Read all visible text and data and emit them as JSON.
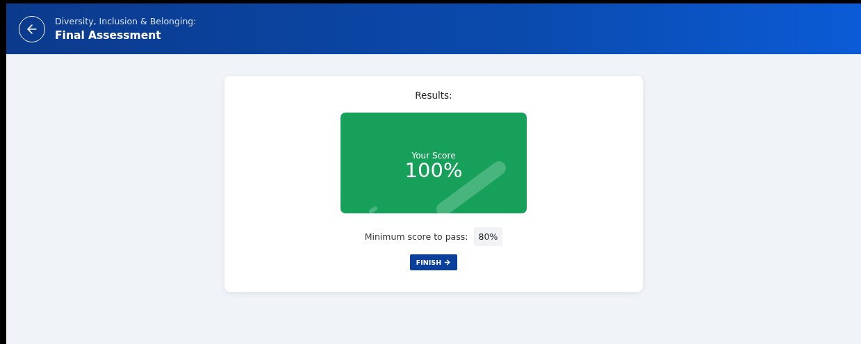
{
  "header": {
    "course": "Diversity, Inclusion & Belonging:",
    "title": "Final Assessment"
  },
  "results": {
    "heading": "Results:",
    "score_label": "Your Score",
    "score": "100%",
    "passed": true,
    "minimum_label": "Minimum score to pass:",
    "minimum": "80%",
    "button": "FINISH"
  }
}
